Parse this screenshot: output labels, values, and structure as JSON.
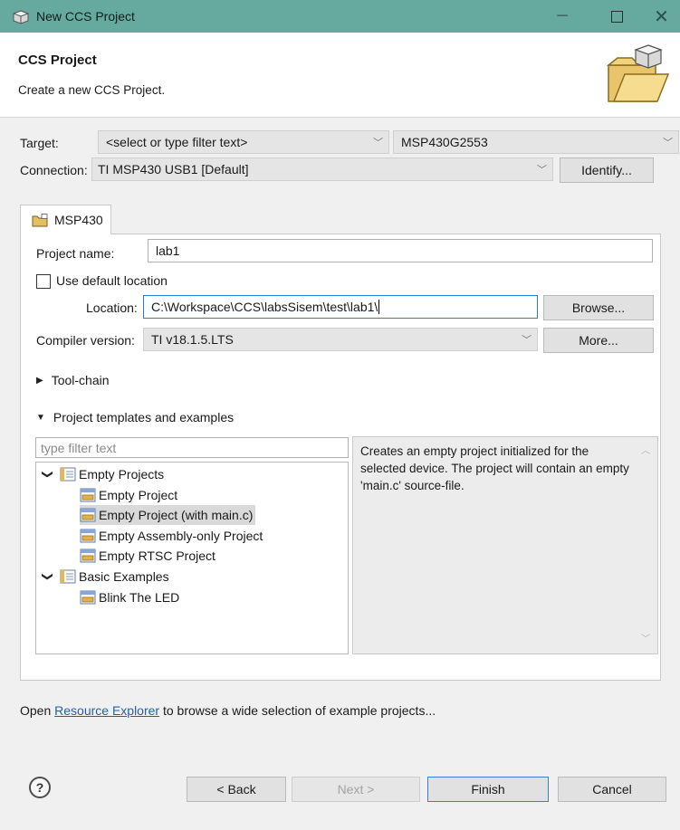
{
  "window": {
    "title": "New CCS Project"
  },
  "header": {
    "title": "CCS Project",
    "description": "Create a new CCS Project."
  },
  "target": {
    "label": "Target:",
    "filter_value": "<select or type filter text>",
    "device_value": "MSP430G2553"
  },
  "connection": {
    "label": "Connection:",
    "value": "TI MSP430 USB1 [Default]",
    "identify_label": "Identify..."
  },
  "tab": {
    "label": "MSP430"
  },
  "project": {
    "name_label": "Project name:",
    "name_value": "lab1",
    "default_location_label": "Use default location",
    "default_location_checked": false,
    "location_label": "Location:",
    "location_value": "C:\\Workspace\\CCS\\labsSisem\\test\\lab1\\",
    "browse_label": "Browse...",
    "compiler_label": "Compiler version:",
    "compiler_value": "TI v18.1.5.LTS",
    "more_label": "More..."
  },
  "sections": {
    "toolchain": "Tool-chain",
    "templates": "Project templates and examples"
  },
  "templates": {
    "filter_placeholder": "type filter text",
    "tree": [
      {
        "label": "Empty Projects",
        "type": "folder"
      },
      {
        "label": "Empty Project",
        "type": "item"
      },
      {
        "label": "Empty Project (with main.c)",
        "type": "item",
        "selected": true
      },
      {
        "label": "Empty Assembly-only Project",
        "type": "item"
      },
      {
        "label": "Empty RTSC Project",
        "type": "item"
      },
      {
        "label": "Basic Examples",
        "type": "folder"
      },
      {
        "label": "Blink The LED",
        "type": "item"
      }
    ],
    "description": "Creates an empty project initialized for the selected device. The project will contain an empty 'main.c' source-file."
  },
  "resource": {
    "prefix": "Open ",
    "link": "Resource Explorer",
    "suffix": " to browse a wide selection of example projects..."
  },
  "footer": {
    "help_symbol": "?",
    "back_label": "< Back",
    "next_label": "Next >",
    "finish_label": "Finish",
    "cancel_label": "Cancel"
  },
  "colors": {
    "titlebar": "#66a99f",
    "focus": "#2f7ad3",
    "link": "#1f5fb8",
    "selection": "#d9d9d9"
  },
  "icons": {
    "app": "ccs-cube-icon",
    "header": "folder-cube-icon",
    "tab": "project-folder-icon",
    "folder": "template-category-icon",
    "item": "template-project-icon"
  }
}
